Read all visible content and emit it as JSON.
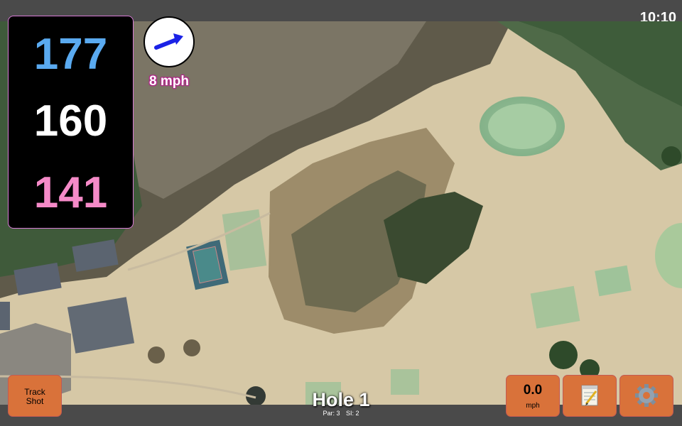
{
  "status": {
    "clock": "10:10"
  },
  "distances": {
    "back": "177",
    "middle": "160",
    "front": "141",
    "colors": {
      "back": "#5aaaf0",
      "middle": "#ffffff",
      "front": "#f58ac8"
    }
  },
  "wind": {
    "speed_label": "8 mph",
    "arrow_icon": "arrow-right-icon"
  },
  "hole": {
    "title": "Hole 1",
    "par": "Par: 3",
    "si": "SI: 2"
  },
  "buttons": {
    "track_shot": {
      "line1": "Track",
      "line2": "Shot"
    },
    "wind_readout": {
      "value": "0.0",
      "unit": "mph"
    },
    "notes_icon": "notepad-icon",
    "settings_icon": "gear-icon",
    "accent": "#d9723a"
  }
}
